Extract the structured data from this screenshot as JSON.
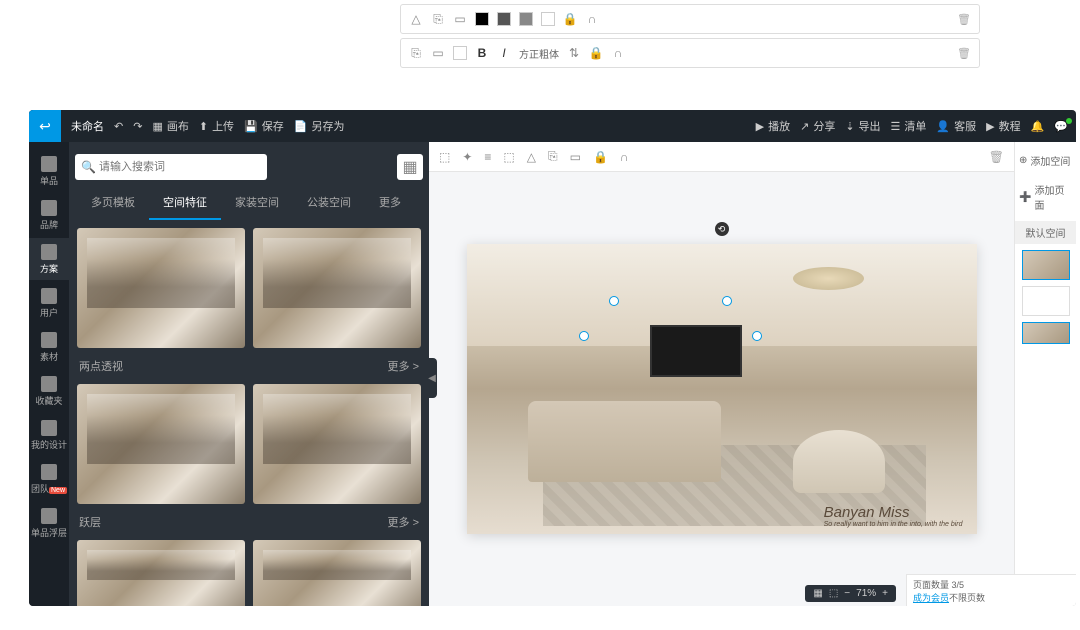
{
  "float1": {
    "trash": "🗑"
  },
  "float2": {
    "bold": "B",
    "italic": "I",
    "font": "方正粗体",
    "trash": "🗑"
  },
  "topbar": {
    "title": "未命名",
    "undo": "↶",
    "redo": "↷",
    "canvas": "画布",
    "upload": "上传",
    "save": "保存",
    "saveas": "另存为",
    "play": "播放",
    "share": "分享",
    "export": "导出",
    "list": "清单",
    "service": "客服",
    "tutorial": "教程"
  },
  "leftnav": {
    "items": [
      {
        "label": "单品"
      },
      {
        "label": "品牌"
      },
      {
        "label": "方案"
      },
      {
        "label": "用户"
      },
      {
        "label": "素材"
      },
      {
        "label": "收藏夹"
      },
      {
        "label": "我的设计"
      },
      {
        "label": "团队",
        "new": "New"
      },
      {
        "label": "单品浮层"
      }
    ]
  },
  "search": {
    "placeholder": "请输入搜索词"
  },
  "tabs": {
    "items": [
      "多页模板",
      "空间特征",
      "家装空间",
      "公装空间"
    ],
    "more": "更多"
  },
  "sections": {
    "s1": "两点透视",
    "s2": "跃层",
    "more": "更多 >"
  },
  "canvas_tb": {
    "icons": [
      "⬚",
      "✦",
      "≡",
      "⬚",
      "△",
      "⎘",
      "▭",
      "🔒",
      "∩"
    ]
  },
  "art": {
    "sig": "Banyan Miss",
    "sub": "So really want to him in the into, with the bird"
  },
  "right": {
    "add_space": "添加空间",
    "add_page": "添加页面",
    "default": "默认空间"
  },
  "zoom": {
    "val": "71%"
  },
  "status": {
    "pages": "页面数量 3/5",
    "upgrade": "成为会员",
    "suffix": "不限页数"
  }
}
